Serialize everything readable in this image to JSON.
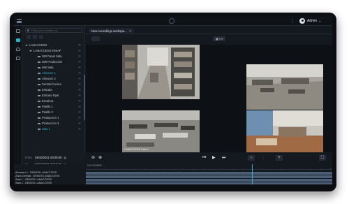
{
  "topbar": {
    "user": "Admin",
    "menu_icon": "hamburger-icon",
    "user_icon": "avatar-icon"
  },
  "search": {
    "placeholder": "Filtrar por nombre, id..."
  },
  "tab": {
    "label": "New recordings workspa...",
    "close": "✕"
  },
  "tree": [
    {
      "label": "LANACCESS",
      "type": "folder",
      "level": 0
    },
    {
      "label": "LANACCESS-ONVIF",
      "type": "folder",
      "level": 1
    },
    {
      "label": "360 Panel Sala",
      "type": "camera",
      "level": 2
    },
    {
      "label": "360 Producción",
      "type": "camera",
      "level": 2
    },
    {
      "label": "360 Sala",
      "type": "camera",
      "level": 2
    },
    {
      "label": "Almacen 1",
      "type": "camera",
      "level": 2,
      "selected": true
    },
    {
      "label": "Almacen 2",
      "type": "camera",
      "level": 2
    },
    {
      "label": "Central Cocina",
      "type": "camera",
      "level": 2
    },
    {
      "label": "Entrada",
      "type": "camera",
      "level": 2
    },
    {
      "label": "Entrada Ppal",
      "type": "camera",
      "level": 2
    },
    {
      "label": "Escalera",
      "type": "camera",
      "level": 2
    },
    {
      "label": "Pasillo 1",
      "type": "camera",
      "level": 2
    },
    {
      "label": "Pasillo 2",
      "type": "camera",
      "level": 2
    },
    {
      "label": "Produccion 1",
      "type": "camera",
      "level": 2
    },
    {
      "label": "Produccion 3",
      "type": "camera",
      "level": 2
    },
    {
      "label": "Sala 1",
      "type": "camera",
      "level": 2,
      "selected": true
    }
  ],
  "dates": {
    "from_label": "From",
    "from": "29/10/2021 00:00:00",
    "to_label": "To",
    "to": "08/11/2021 23:59:59",
    "range": "07/11/121 - 15:10:23"
  },
  "layout_label": "1",
  "feeds": [
    {
      "label": ""
    },
    {
      "label": ""
    },
    {
      "label": "LANACCESS Sala 1"
    },
    {
      "label": ""
    }
  ],
  "timeline": {
    "ruler_label": "NOVIEMBRE",
    "rows": [
      {
        "label": "Almacen 1 - DEMOS LANACCESS"
      },
      {
        "label": "Zona Central - DEMOS LANACCESS"
      },
      {
        "label": "Sala 1 - DEMOS LANACCESS"
      },
      {
        "label": "Sala 2 - DEMOS LANACCESS"
      }
    ]
  },
  "colors": {
    "accent": "#2bb3c8",
    "background": "#14181f",
    "panel": "#161b22"
  }
}
